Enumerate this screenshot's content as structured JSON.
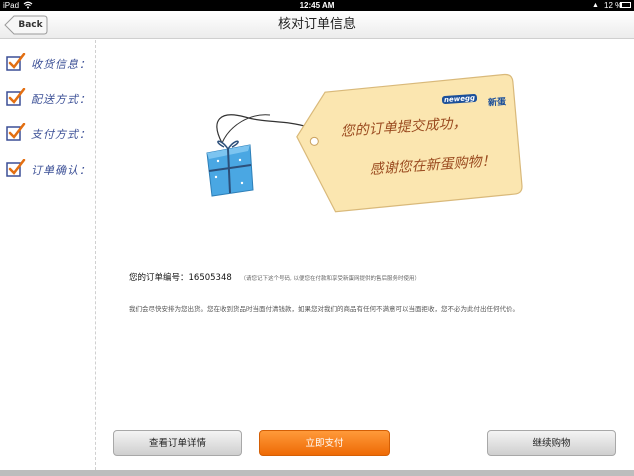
{
  "status_bar": {
    "carrier": "iPad",
    "time": "12:45 AM",
    "battery": "12 %",
    "battery_level": 0.12
  },
  "nav": {
    "back_label": "Back",
    "title": "核对订单信息"
  },
  "sidebar": {
    "steps": [
      {
        "label": "收货信息：",
        "checked": true
      },
      {
        "label": "配送方式：",
        "checked": true
      },
      {
        "label": "支付方式：",
        "checked": true
      },
      {
        "label": "订单确认：",
        "checked": true
      }
    ]
  },
  "tag": {
    "line1": "您的订单提交成功，",
    "line2": "感谢您在新蛋购物！",
    "logo_text": "newegg",
    "logo_cn": "新蛋"
  },
  "order": {
    "number_label": "您的订单编号：",
    "number": "16505348",
    "note": "（请您记下这个号码, 以便您在付款和享受新蛋网提供的售后服务时使用）",
    "info": "我们会尽快安排为您出货。您在收到货品时当面付清钱款，如果您对我们的商品有任何不满意可以当面拒收，您不必为此付出任何代价。"
  },
  "buttons": {
    "details": "查看订单详情",
    "pay": "立即支付",
    "continue": "继续购物"
  },
  "colors": {
    "accent": "#ee6a05",
    "tag": "#fbe6b0",
    "tag_text": "#9a4a1f",
    "sidebar_text": "#3b4f96"
  }
}
